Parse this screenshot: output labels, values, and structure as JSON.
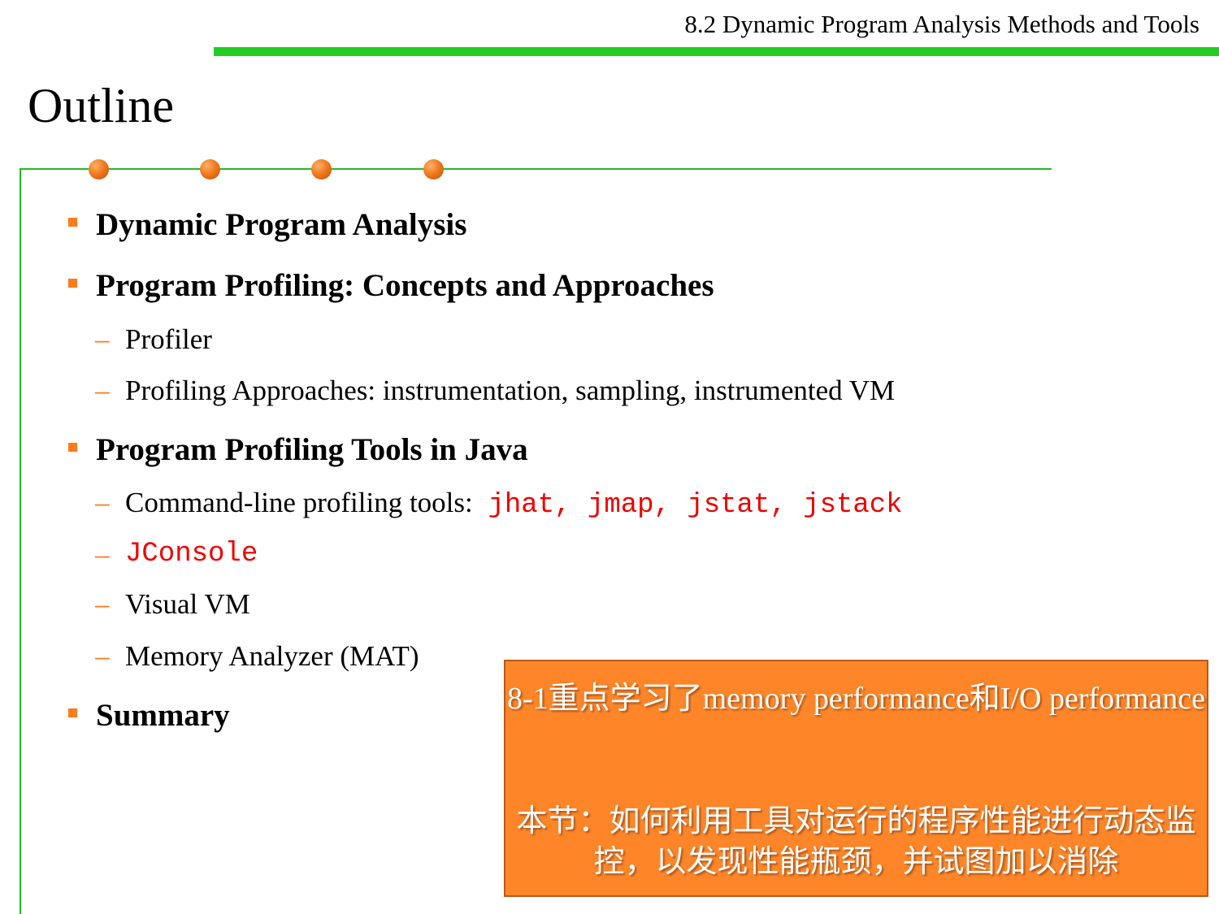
{
  "header": {
    "section_title": "8.2 Dynamic Program Analysis Methods and Tools",
    "accent_color": "#22cc22"
  },
  "slide": {
    "title": "Outline",
    "bullet_color": "#ff7a1a",
    "items": [
      {
        "label": "Dynamic Program Analysis"
      },
      {
        "label": "Program Profiling: Concepts and Approaches",
        "children": [
          {
            "label": "Profiler"
          },
          {
            "label": "Profiling Approaches: instrumentation, sampling, instrumented VM"
          }
        ]
      },
      {
        "label": "Program Profiling Tools in Java",
        "children": [
          {
            "label": "Command-line profiling tools:",
            "code": "jhat, jmap, jstat, jstack"
          },
          {
            "code": "JConsole"
          },
          {
            "label": "Visual VM"
          },
          {
            "label": "Memory Analyzer (MAT)"
          }
        ]
      },
      {
        "label": "Summary"
      }
    ]
  },
  "callout": {
    "background": "#ff8529",
    "line1": "8-1重点学习了memory performance和I/O performance",
    "line2": "本节：如何利用工具对运行的程序性能进行动态监控，以发现性能瓶颈，并试图加以消除"
  }
}
